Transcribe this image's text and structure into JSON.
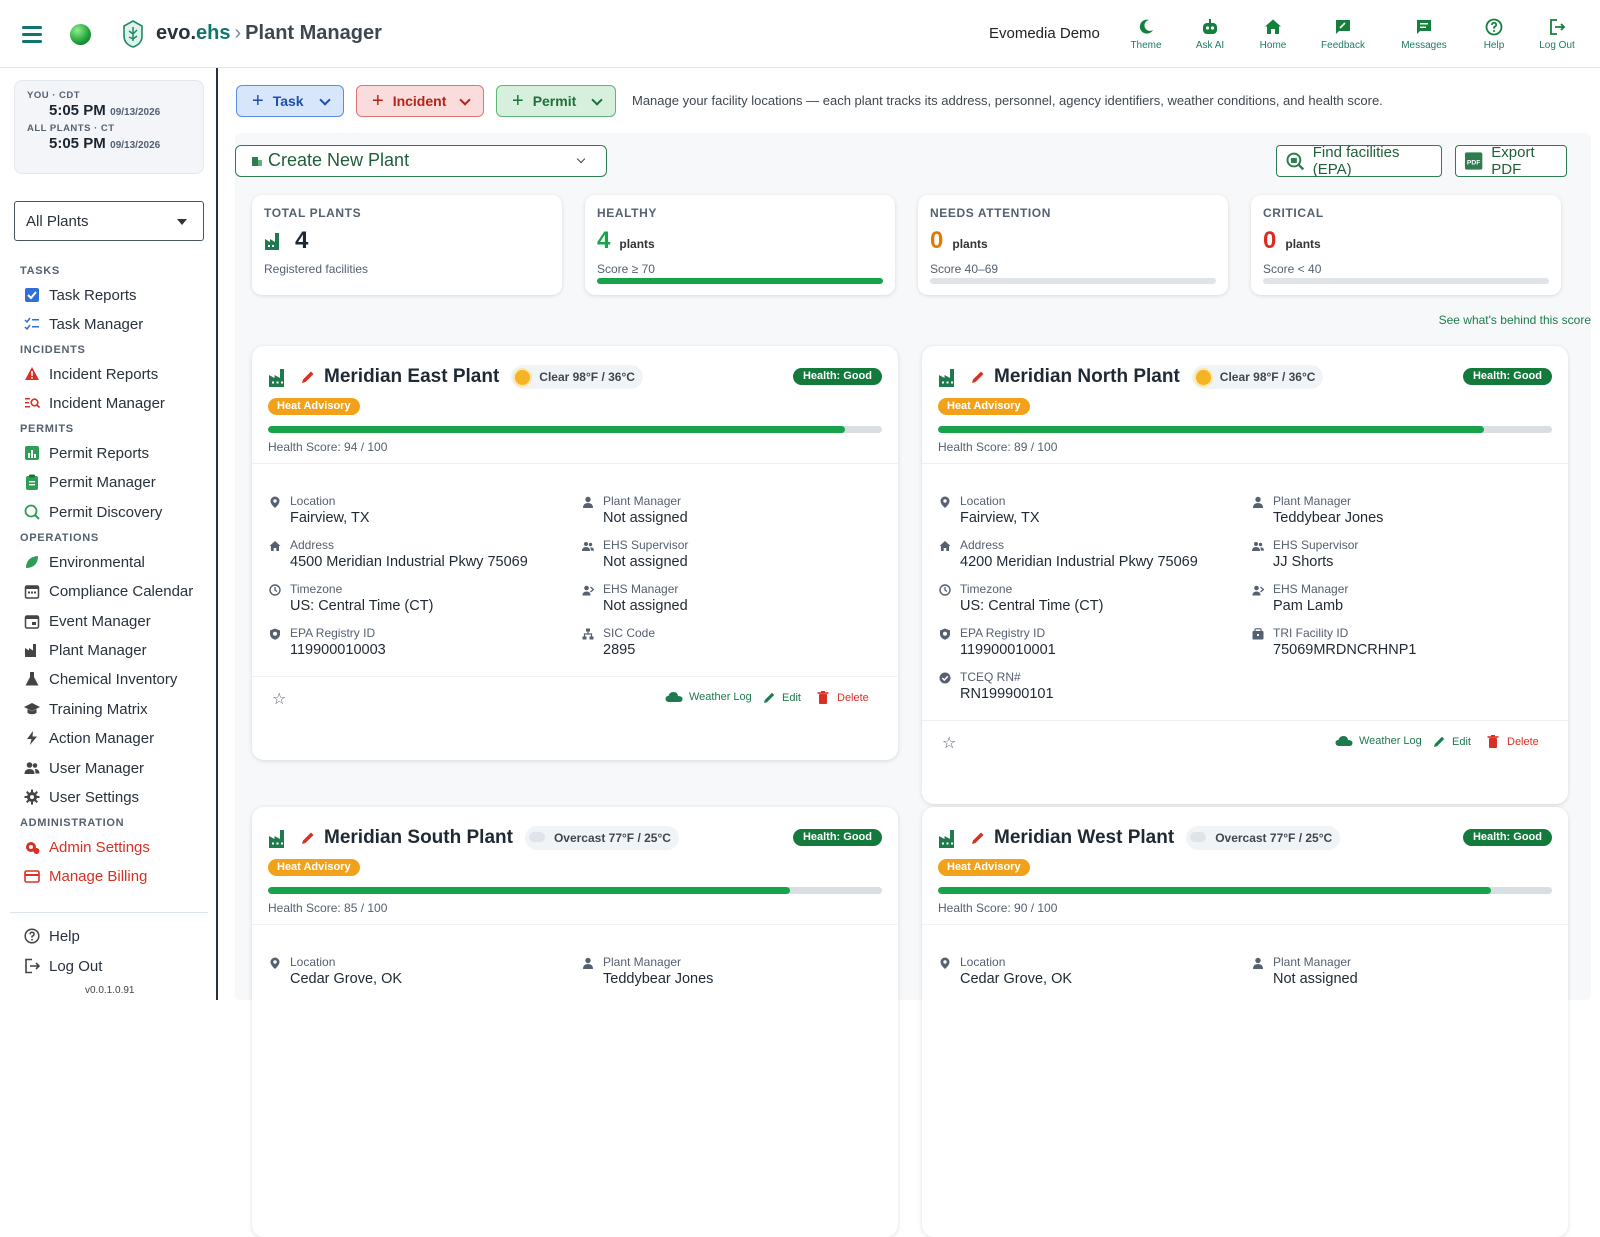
{
  "brand": {
    "evo": "evo.",
    "ehs": "ehs",
    "sep": "›",
    "page": "Plant Manager"
  },
  "org_name": "Evomedia Demo",
  "topnav": [
    {
      "label": "Theme",
      "icon": "moon-icon"
    },
    {
      "label": "Ask AI",
      "icon": "robot-icon"
    },
    {
      "label": "Home",
      "icon": "home-icon"
    },
    {
      "label": "Feedback",
      "icon": "feedback-icon"
    },
    {
      "label": "Messages",
      "icon": "messages-icon"
    },
    {
      "label": "Help",
      "icon": "help-icon"
    },
    {
      "label": "Log Out",
      "icon": "logout-icon"
    }
  ],
  "clock": {
    "you_label": "YOU · CDT",
    "you_time": "5:05 PM",
    "you_date": "09/13/2026",
    "all_label": "ALL PLANTS · CT",
    "all_time": "5:05 PM",
    "all_date": "09/13/2026"
  },
  "plant_selector": {
    "value": "All Plants"
  },
  "sidebar": {
    "tasks": "TASKS",
    "incidents": "INCIDENTS",
    "permits": "PERMITS",
    "operations": "OPERATIONS",
    "administration": "ADMINISTRATION",
    "task_reports": "Task Reports",
    "task_manager": "Task Manager",
    "incident_reports": "Incident Reports",
    "incident_manager": "Incident Manager",
    "permit_reports": "Permit Reports",
    "permit_manager": "Permit Manager",
    "permit_discovery": "Permit Discovery",
    "environmental": "Environmental",
    "compliance_calendar": "Compliance Calendar",
    "event_manager": "Event Manager",
    "plant_manager": "Plant Manager",
    "chemical_inventory": "Chemical Inventory",
    "training_matrix": "Training Matrix",
    "action_manager": "Action Manager",
    "user_manager": "User Manager",
    "user_settings": "User Settings",
    "admin_settings": "Admin Settings",
    "manage_billing": "Manage Billing",
    "help": "Help",
    "logout": "Log Out",
    "version": "v0.0.1.0.91"
  },
  "actions": {
    "task": "Task",
    "incident": "Incident",
    "permit": "Permit"
  },
  "hint": "Manage your facility locations — each plant tracks its address, personnel, agency identifiers, weather conditions, and health score.",
  "toolbar": {
    "create": "Create New Plant",
    "find": "Find facilities (EPA)",
    "export": "Export PDF"
  },
  "stats": {
    "total": {
      "label": "TOTAL PLANTS",
      "value": "4",
      "sub": "Registered facilities"
    },
    "healthy": {
      "label": "HEALTHY",
      "value": "4",
      "unit": "plants",
      "sub": "Score ≥ 70",
      "fill": 1.0
    },
    "attention": {
      "label": "NEEDS ATTENTION",
      "value": "0",
      "unit": "plants",
      "sub": "Score 40–69",
      "fill": 0
    },
    "critical": {
      "label": "CRITICAL",
      "value": "0",
      "unit": "plants",
      "sub": "Score < 40",
      "fill": 0
    }
  },
  "see_score": "See what's behind this score",
  "colors": {
    "good": "#16a34a",
    "warn": "#e07b00",
    "bad": "#d92d20",
    "brand": "#0f766e"
  },
  "cards": [
    {
      "name": "Meridian East Plant",
      "weather": "Clear 98°F / 36°C",
      "weather_icon": "sun-icon",
      "health": "Health: Good",
      "advisory": "Heat Advisory",
      "score_text": "Health Score: 94 / 100",
      "score": 94,
      "fields": [
        {
          "l": "Location",
          "v": "Fairview, TX",
          "icon": "pin-icon"
        },
        {
          "l": "Plant Manager",
          "v": "Not assigned",
          "icon": "person-icon"
        },
        {
          "l": "Address",
          "v": "4500 Meridian Industrial Pkwy 75069",
          "icon": "home-icon"
        },
        {
          "l": "EHS Supervisor",
          "v": "Not assigned",
          "icon": "group-icon"
        },
        {
          "l": "Timezone",
          "v": "US: Central Time (CT)",
          "icon": "clock-icon"
        },
        {
          "l": "EHS Manager",
          "v": "Not assigned",
          "icon": "manager-icon"
        },
        {
          "l": "EPA Registry ID",
          "v": "119900010003",
          "icon": "shield-icon"
        },
        {
          "l": "SIC Code",
          "v": "2895",
          "icon": "sitemap-icon"
        }
      ],
      "weather_log": "Weather Log",
      "edit": "Edit",
      "delete": "Delete"
    },
    {
      "name": "Meridian North Plant",
      "weather": "Clear 98°F / 36°C",
      "weather_icon": "sun-icon",
      "health": "Health: Good",
      "advisory": "Heat Advisory",
      "score_text": "Health Score: 89 / 100",
      "score": 89,
      "fields": [
        {
          "l": "Location",
          "v": "Fairview, TX",
          "icon": "pin-icon"
        },
        {
          "l": "Plant Manager",
          "v": "Teddybear Jones",
          "icon": "person-icon"
        },
        {
          "l": "Address",
          "v": "4200 Meridian Industrial Pkwy 75069",
          "icon": "home-icon"
        },
        {
          "l": "EHS Supervisor",
          "v": "JJ Shorts",
          "icon": "group-icon"
        },
        {
          "l": "Timezone",
          "v": "US: Central Time (CT)",
          "icon": "clock-icon"
        },
        {
          "l": "EHS Manager",
          "v": "Pam Lamb",
          "icon": "manager-icon"
        },
        {
          "l": "EPA Registry ID",
          "v": "119900010001",
          "icon": "shield-icon"
        },
        {
          "l": "TRI Facility ID",
          "v": "75069MRDNCRHNP1",
          "icon": "factory-icon"
        },
        {
          "l": "TCEQ RN#",
          "v": "RN199900101",
          "icon": "check-badge-icon"
        }
      ],
      "weather_log": "Weather Log",
      "edit": "Edit",
      "delete": "Delete"
    },
    {
      "name": "Meridian South Plant",
      "weather": "Overcast 77°F / 25°C",
      "weather_icon": "cloud-icon",
      "health": "Health: Good",
      "advisory": "Heat Advisory",
      "score_text": "Health Score: 85 / 100",
      "score": 85,
      "fields": [
        {
          "l": "Location",
          "v": "Cedar Grove, OK",
          "icon": "pin-icon"
        },
        {
          "l": "Plant Manager",
          "v": "Teddybear Jones",
          "icon": "person-icon"
        }
      ]
    },
    {
      "name": "Meridian West Plant",
      "weather": "Overcast 77°F / 25°C",
      "weather_icon": "cloud-icon",
      "health": "Health: Good",
      "advisory": "Heat Advisory",
      "score_text": "Health Score: 90 / 100",
      "score": 90,
      "fields": [
        {
          "l": "Location",
          "v": "Cedar Grove, OK",
          "icon": "pin-icon"
        },
        {
          "l": "Plant Manager",
          "v": "Not assigned",
          "icon": "person-icon"
        }
      ]
    }
  ]
}
